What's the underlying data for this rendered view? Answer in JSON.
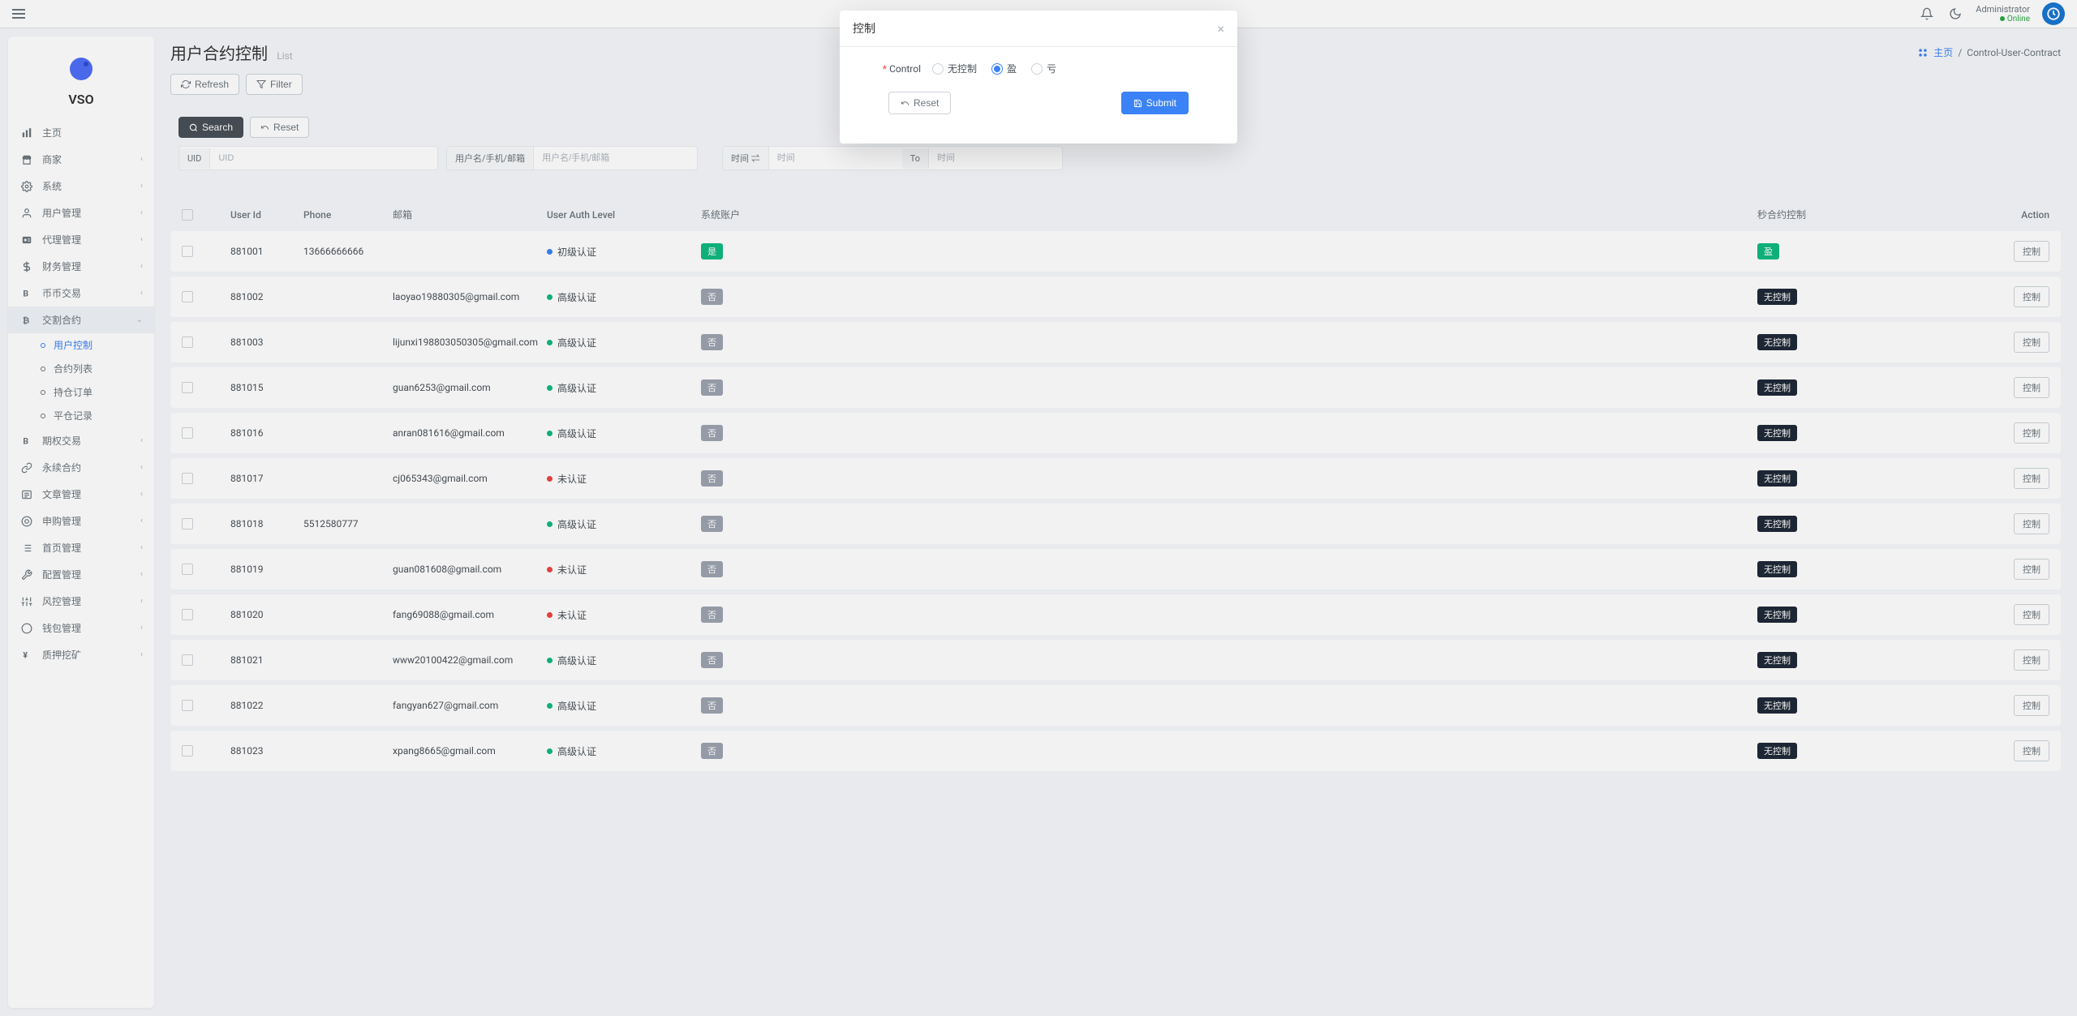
{
  "topbar": {
    "user_name": "Administrator",
    "user_status": "Online"
  },
  "brand": {
    "name": "VSO"
  },
  "nav": {
    "items": [
      {
        "label": "主页",
        "icon": "home",
        "expandable": false
      },
      {
        "label": "商家",
        "icon": "merchant",
        "expandable": true
      },
      {
        "label": "系统",
        "icon": "system",
        "expandable": true
      },
      {
        "label": "用户管理",
        "icon": "users",
        "expandable": true
      },
      {
        "label": "代理管理",
        "icon": "agent",
        "expandable": true
      },
      {
        "label": "财务管理",
        "icon": "finance",
        "expandable": true
      },
      {
        "label": "币币交易",
        "icon": "coin",
        "expandable": true
      },
      {
        "label": "交割合约",
        "icon": "contract",
        "expandable": true,
        "expanded": true,
        "children": [
          {
            "label": "用户控制",
            "active": true
          },
          {
            "label": "合约列表"
          },
          {
            "label": "持仓订单"
          },
          {
            "label": "平仓记录"
          }
        ]
      },
      {
        "label": "期权交易",
        "icon": "option",
        "expandable": true
      },
      {
        "label": "永续合约",
        "icon": "perpetual",
        "expandable": true
      },
      {
        "label": "文章管理",
        "icon": "article",
        "expandable": true
      },
      {
        "label": "申购管理",
        "icon": "subscribe",
        "expandable": true
      },
      {
        "label": "首页管理",
        "icon": "homepage",
        "expandable": true
      },
      {
        "label": "配置管理",
        "icon": "config",
        "expandable": true
      },
      {
        "label": "风控管理",
        "icon": "risk",
        "expandable": true
      },
      {
        "label": "钱包管理",
        "icon": "wallet",
        "expandable": true
      },
      {
        "label": "质押挖矿",
        "icon": "stake",
        "expandable": true
      }
    ]
  },
  "page": {
    "title": "用户合约控制",
    "subtitle": "List",
    "breadcrumb_home": "主页",
    "breadcrumb_current": "Control-User-Contract",
    "refresh_label": "Refresh",
    "filter_label": "Filter",
    "search_label": "Search",
    "reset_label": "Reset"
  },
  "filters": {
    "uid_label": "UID",
    "uid_placeholder": "UID",
    "user_label": "用户名/手机/邮箱",
    "user_placeholder": "用户名/手机/邮箱",
    "time_label": "时间 ⇌",
    "time_placeholder": "时间",
    "to_label": "To",
    "to_placeholder": "时间"
  },
  "table": {
    "headers": {
      "user_id": "User Id",
      "phone": "Phone",
      "email": "邮箱",
      "auth_level": "User Auth Level",
      "sys_account": "系统账户",
      "sec_control": "秒合约控制",
      "action": "Action"
    },
    "action_label": "控制",
    "rows": [
      {
        "user_id": "881001",
        "phone": "13666666666",
        "email": "",
        "auth": "初级认证",
        "auth_color": "blue",
        "sys": "是",
        "sys_color": "green",
        "ctrl": "盈",
        "ctrl_color": "green"
      },
      {
        "user_id": "881002",
        "phone": "",
        "email": "laoyao19880305@gmail.com",
        "auth": "高级认证",
        "auth_color": "green",
        "sys": "否",
        "sys_color": "gray",
        "ctrl": "无控制",
        "ctrl_color": "black"
      },
      {
        "user_id": "881003",
        "phone": "",
        "email": "lijunxi198803050305@gmail.com",
        "auth": "高级认证",
        "auth_color": "green",
        "sys": "否",
        "sys_color": "gray",
        "ctrl": "无控制",
        "ctrl_color": "black"
      },
      {
        "user_id": "881015",
        "phone": "",
        "email": "guan6253@gmail.com",
        "auth": "高级认证",
        "auth_color": "green",
        "sys": "否",
        "sys_color": "gray",
        "ctrl": "无控制",
        "ctrl_color": "black"
      },
      {
        "user_id": "881016",
        "phone": "",
        "email": "anran081616@gmail.com",
        "auth": "高级认证",
        "auth_color": "green",
        "sys": "否",
        "sys_color": "gray",
        "ctrl": "无控制",
        "ctrl_color": "black"
      },
      {
        "user_id": "881017",
        "phone": "",
        "email": "cj065343@gmail.com",
        "auth": "未认证",
        "auth_color": "red",
        "sys": "否",
        "sys_color": "gray",
        "ctrl": "无控制",
        "ctrl_color": "black"
      },
      {
        "user_id": "881018",
        "phone": "5512580777",
        "email": "",
        "auth": "高级认证",
        "auth_color": "green",
        "sys": "否",
        "sys_color": "gray",
        "ctrl": "无控制",
        "ctrl_color": "black"
      },
      {
        "user_id": "881019",
        "phone": "",
        "email": "guan081608@gmail.com",
        "auth": "未认证",
        "auth_color": "red",
        "sys": "否",
        "sys_color": "gray",
        "ctrl": "无控制",
        "ctrl_color": "black"
      },
      {
        "user_id": "881020",
        "phone": "",
        "email": "fang69088@gmail.com",
        "auth": "未认证",
        "auth_color": "red",
        "sys": "否",
        "sys_color": "gray",
        "ctrl": "无控制",
        "ctrl_color": "black"
      },
      {
        "user_id": "881021",
        "phone": "",
        "email": "www20100422@gmail.com",
        "auth": "高级认证",
        "auth_color": "green",
        "sys": "否",
        "sys_color": "gray",
        "ctrl": "无控制",
        "ctrl_color": "black"
      },
      {
        "user_id": "881022",
        "phone": "",
        "email": "fangyan627@gmail.com",
        "auth": "高级认证",
        "auth_color": "green",
        "sys": "否",
        "sys_color": "gray",
        "ctrl": "无控制",
        "ctrl_color": "black"
      },
      {
        "user_id": "881023",
        "phone": "",
        "email": "xpang8665@gmail.com",
        "auth": "高级认证",
        "auth_color": "green",
        "sys": "否",
        "sys_color": "gray",
        "ctrl": "无控制",
        "ctrl_color": "black"
      }
    ]
  },
  "modal": {
    "title": "控制",
    "control_label": "Control",
    "options": [
      {
        "label": "无控制",
        "checked": false
      },
      {
        "label": "盈",
        "checked": true
      },
      {
        "label": "亏",
        "checked": false
      }
    ],
    "reset_label": "Reset",
    "submit_label": "Submit"
  }
}
